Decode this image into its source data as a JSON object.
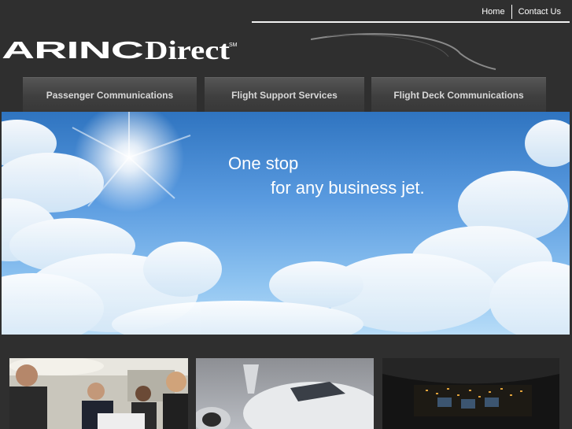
{
  "top_links": {
    "home": "Home",
    "contact": "Contact Us"
  },
  "logo": {
    "text": "ARINCDirect",
    "mark": "SM"
  },
  "nav": {
    "tabs": [
      {
        "label": "Passenger Communications"
      },
      {
        "label": "Flight Support Services"
      },
      {
        "label": "Flight Deck Communications"
      }
    ]
  },
  "hero": {
    "line1": "One stop",
    "line2": "for any business jet."
  },
  "thumbnails": [
    {
      "subject": "passengers-in-cabin"
    },
    {
      "subject": "business-jet-nose"
    },
    {
      "subject": "cockpit-at-night"
    }
  ],
  "colors": {
    "background": "#2f2f2f",
    "nav_text": "#d8d8d8",
    "sky": "#5a9be0"
  }
}
